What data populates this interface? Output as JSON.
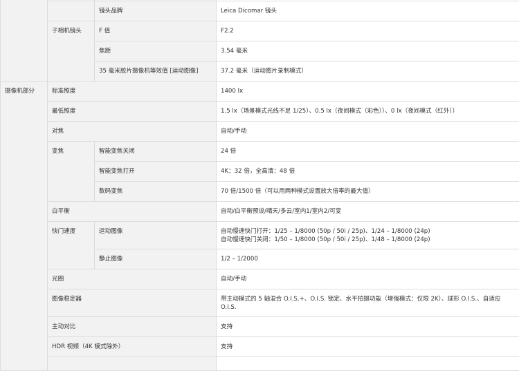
{
  "rows": [
    {
      "id": "r0",
      "label3": "",
      "value": ""
    },
    {
      "id": "r1",
      "label3": "镜头品牌",
      "value": "Leica Dicomar 镜头"
    },
    {
      "id": "r2",
      "label2": "子相机镜头",
      "label3": "F 值",
      "value": "F2.2"
    },
    {
      "id": "r3",
      "label3": "焦距",
      "value": "3.54 毫米"
    },
    {
      "id": "r4",
      "label3": "35 毫米胶片摄像机等效值 [运动图像]",
      "value": "37.2 毫米（运动图片录制模式）"
    },
    {
      "id": "r5",
      "label1": "摄像机部分",
      "label2": "标准照度",
      "value": "1400 lx"
    },
    {
      "id": "r6",
      "label2": "最低照度",
      "value": "1.5 lx（场景模式光线不足 1/25）、0.5 lx（夜间模式（彩色））、0 lx（夜间模式（红外））"
    },
    {
      "id": "r7",
      "label2": "对焦",
      "value": "自动/手动"
    },
    {
      "id": "r8",
      "label2": "变焦",
      "label3": "智能变焦关闭",
      "value": "24 倍"
    },
    {
      "id": "r9",
      "label3": "智能变焦打开",
      "value": "4K：32 倍，全高清：48 倍"
    },
    {
      "id": "r10",
      "label3": "数码变焦",
      "value": "70 倍/1500 倍（可以用两种模式设置放大倍率的最大值）"
    },
    {
      "id": "r11",
      "label2": "白平衡",
      "value": "自动/白平衡预设/晴天/多云/室内1/室内2/可变"
    },
    {
      "id": "r12",
      "label2": "快门速度",
      "label3": "运动图像",
      "value_lines": [
        "自动慢速快门打开：1/25 – 1/8000 (50p / 50i / 25p)、1/24 – 1/8000 (24p)",
        "自动慢速快门关闭：1/50 – 1/8000 (50p / 50i / 25p)、1/48 – 1/8000 (24p)"
      ]
    },
    {
      "id": "r13",
      "label3": "静止图像",
      "value": "1/2 – 1/2000"
    },
    {
      "id": "r14",
      "label2": "光圈",
      "value": "自动/手动"
    },
    {
      "id": "r15",
      "label2": "图像稳定器",
      "value": "带主动模式的 5 轴混合 O.I.S.+、O.I.S. 锁定、水平拍摄功能（增强模式：仅限 2K）、球形 O.I.S.、自适应 O.I.S."
    },
    {
      "id": "r16",
      "label2": "主动对比",
      "value": "支持"
    },
    {
      "id": "r17",
      "label2": "HDR 视频（4K 模式除外）",
      "value": "支持"
    },
    {
      "id": "r18",
      "label2": "",
      "value": ""
    }
  ]
}
